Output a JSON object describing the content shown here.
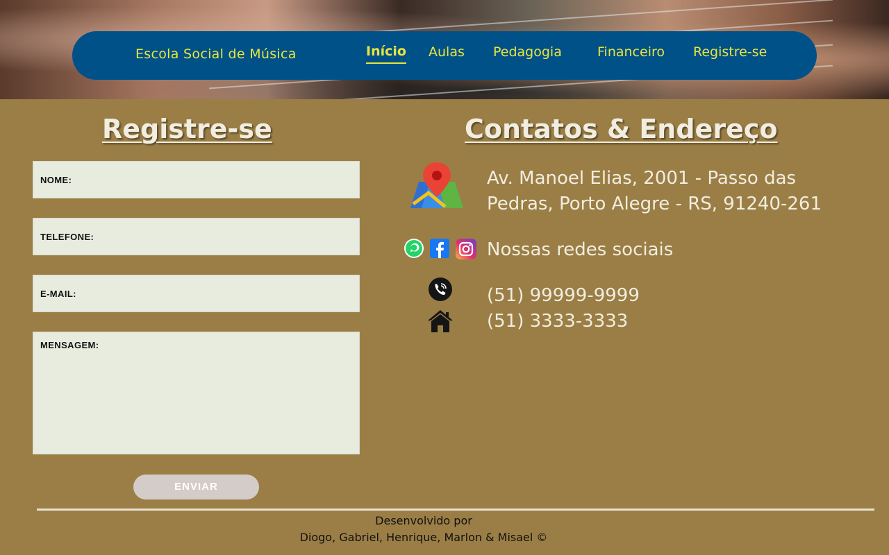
{
  "nav": {
    "brand": "Escola Social de Música",
    "items": [
      {
        "label": "Início",
        "active": true
      },
      {
        "label": "Aulas"
      },
      {
        "label": "Pedagogia"
      },
      {
        "label": "Financeiro"
      },
      {
        "label": "Registre-se"
      }
    ]
  },
  "form": {
    "title": "Registre-se",
    "fields": {
      "nome": "NOME:",
      "telefone": "TELEFONE:",
      "email": "E-MAIL:",
      "mensagem": "MENSAGEM:"
    },
    "submit": "ENVIAR"
  },
  "contacts": {
    "title": "Contatos & Endereço",
    "address_line1": "Av. Manoel Elias, 2001 - Passo das",
    "address_line2": "Pedras, Porto Alegre - RS, 91240-261",
    "social_label": "Nossas redes sociais",
    "phone_mobile": "(51) 99999-9999",
    "phone_home": "(51) 3333-3333"
  },
  "footer": {
    "line1": "Desenvolvido por",
    "line2": "Diogo, Gabriel, Henrique, Marlon & Misael ©"
  },
  "colors": {
    "page_bg": "#9b7e45",
    "nav_bg": "#015189",
    "nav_text": "#e8e63c",
    "input_bg": "#e8ecdf",
    "button_bg": "#d4ccc9"
  },
  "icons": [
    "map-pin-icon",
    "whatsapp-icon",
    "facebook-icon",
    "instagram-icon",
    "phone-icon",
    "home-icon"
  ]
}
